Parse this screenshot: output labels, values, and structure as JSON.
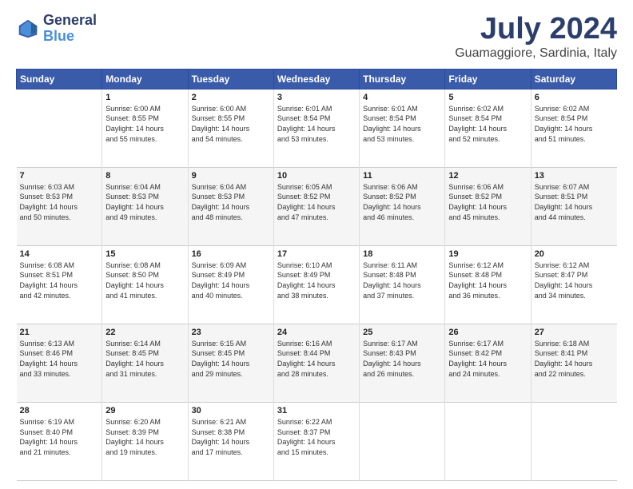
{
  "header": {
    "logo_line1": "General",
    "logo_line2": "Blue",
    "month_title": "July 2024",
    "location": "Guamaggiore, Sardinia, Italy"
  },
  "weekdays": [
    "Sunday",
    "Monday",
    "Tuesday",
    "Wednesday",
    "Thursday",
    "Friday",
    "Saturday"
  ],
  "weeks": [
    [
      {
        "day": "",
        "info": ""
      },
      {
        "day": "1",
        "info": "Sunrise: 6:00 AM\nSunset: 8:55 PM\nDaylight: 14 hours\nand 55 minutes."
      },
      {
        "day": "2",
        "info": "Sunrise: 6:00 AM\nSunset: 8:55 PM\nDaylight: 14 hours\nand 54 minutes."
      },
      {
        "day": "3",
        "info": "Sunrise: 6:01 AM\nSunset: 8:54 PM\nDaylight: 14 hours\nand 53 minutes."
      },
      {
        "day": "4",
        "info": "Sunrise: 6:01 AM\nSunset: 8:54 PM\nDaylight: 14 hours\nand 53 minutes."
      },
      {
        "day": "5",
        "info": "Sunrise: 6:02 AM\nSunset: 8:54 PM\nDaylight: 14 hours\nand 52 minutes."
      },
      {
        "day": "6",
        "info": "Sunrise: 6:02 AM\nSunset: 8:54 PM\nDaylight: 14 hours\nand 51 minutes."
      }
    ],
    [
      {
        "day": "7",
        "info": "Sunrise: 6:03 AM\nSunset: 8:53 PM\nDaylight: 14 hours\nand 50 minutes."
      },
      {
        "day": "8",
        "info": "Sunrise: 6:04 AM\nSunset: 8:53 PM\nDaylight: 14 hours\nand 49 minutes."
      },
      {
        "day": "9",
        "info": "Sunrise: 6:04 AM\nSunset: 8:53 PM\nDaylight: 14 hours\nand 48 minutes."
      },
      {
        "day": "10",
        "info": "Sunrise: 6:05 AM\nSunset: 8:52 PM\nDaylight: 14 hours\nand 47 minutes."
      },
      {
        "day": "11",
        "info": "Sunrise: 6:06 AM\nSunset: 8:52 PM\nDaylight: 14 hours\nand 46 minutes."
      },
      {
        "day": "12",
        "info": "Sunrise: 6:06 AM\nSunset: 8:52 PM\nDaylight: 14 hours\nand 45 minutes."
      },
      {
        "day": "13",
        "info": "Sunrise: 6:07 AM\nSunset: 8:51 PM\nDaylight: 14 hours\nand 44 minutes."
      }
    ],
    [
      {
        "day": "14",
        "info": "Sunrise: 6:08 AM\nSunset: 8:51 PM\nDaylight: 14 hours\nand 42 minutes."
      },
      {
        "day": "15",
        "info": "Sunrise: 6:08 AM\nSunset: 8:50 PM\nDaylight: 14 hours\nand 41 minutes."
      },
      {
        "day": "16",
        "info": "Sunrise: 6:09 AM\nSunset: 8:49 PM\nDaylight: 14 hours\nand 40 minutes."
      },
      {
        "day": "17",
        "info": "Sunrise: 6:10 AM\nSunset: 8:49 PM\nDaylight: 14 hours\nand 38 minutes."
      },
      {
        "day": "18",
        "info": "Sunrise: 6:11 AM\nSunset: 8:48 PM\nDaylight: 14 hours\nand 37 minutes."
      },
      {
        "day": "19",
        "info": "Sunrise: 6:12 AM\nSunset: 8:48 PM\nDaylight: 14 hours\nand 36 minutes."
      },
      {
        "day": "20",
        "info": "Sunrise: 6:12 AM\nSunset: 8:47 PM\nDaylight: 14 hours\nand 34 minutes."
      }
    ],
    [
      {
        "day": "21",
        "info": "Sunrise: 6:13 AM\nSunset: 8:46 PM\nDaylight: 14 hours\nand 33 minutes."
      },
      {
        "day": "22",
        "info": "Sunrise: 6:14 AM\nSunset: 8:45 PM\nDaylight: 14 hours\nand 31 minutes."
      },
      {
        "day": "23",
        "info": "Sunrise: 6:15 AM\nSunset: 8:45 PM\nDaylight: 14 hours\nand 29 minutes."
      },
      {
        "day": "24",
        "info": "Sunrise: 6:16 AM\nSunset: 8:44 PM\nDaylight: 14 hours\nand 28 minutes."
      },
      {
        "day": "25",
        "info": "Sunrise: 6:17 AM\nSunset: 8:43 PM\nDaylight: 14 hours\nand 26 minutes."
      },
      {
        "day": "26",
        "info": "Sunrise: 6:17 AM\nSunset: 8:42 PM\nDaylight: 14 hours\nand 24 minutes."
      },
      {
        "day": "27",
        "info": "Sunrise: 6:18 AM\nSunset: 8:41 PM\nDaylight: 14 hours\nand 22 minutes."
      }
    ],
    [
      {
        "day": "28",
        "info": "Sunrise: 6:19 AM\nSunset: 8:40 PM\nDaylight: 14 hours\nand 21 minutes."
      },
      {
        "day": "29",
        "info": "Sunrise: 6:20 AM\nSunset: 8:39 PM\nDaylight: 14 hours\nand 19 minutes."
      },
      {
        "day": "30",
        "info": "Sunrise: 6:21 AM\nSunset: 8:38 PM\nDaylight: 14 hours\nand 17 minutes."
      },
      {
        "day": "31",
        "info": "Sunrise: 6:22 AM\nSunset: 8:37 PM\nDaylight: 14 hours\nand 15 minutes."
      },
      {
        "day": "",
        "info": ""
      },
      {
        "day": "",
        "info": ""
      },
      {
        "day": "",
        "info": ""
      }
    ]
  ]
}
